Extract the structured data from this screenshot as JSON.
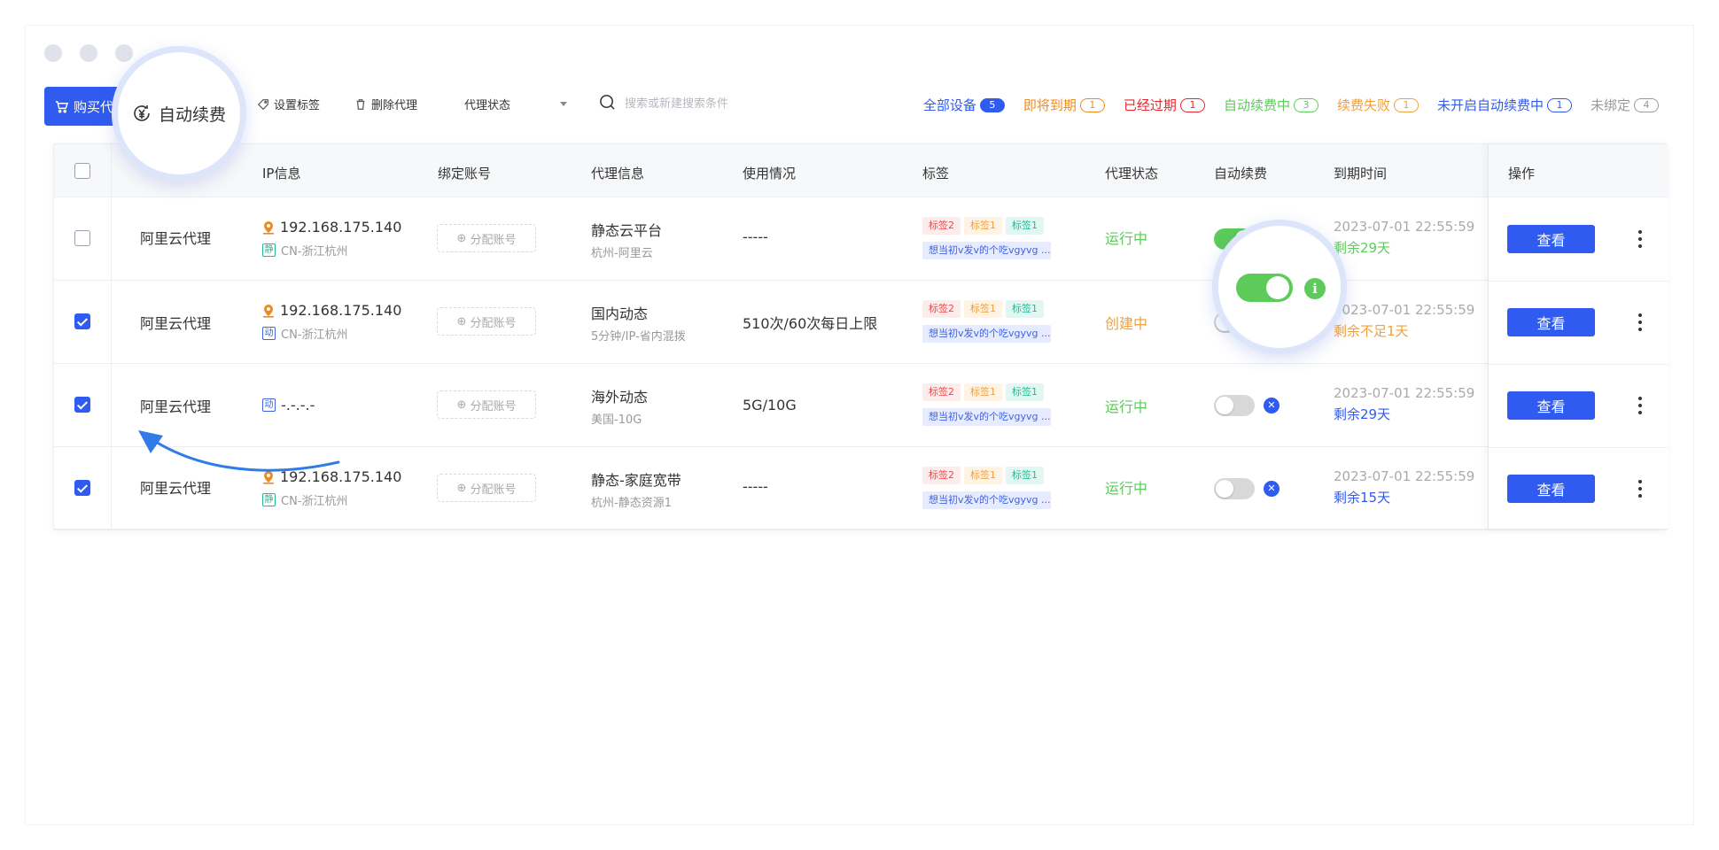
{
  "toolbar": {
    "buy_label": "购买代",
    "set_tag_label": "设置标签",
    "delete_label": "删除代理",
    "status_select_label": "代理状态",
    "search_placeholder": "搜索或新建搜索条件"
  },
  "callout": {
    "auto_renew_label": "自动续费"
  },
  "filters": [
    {
      "label": "全部设备",
      "count": "5",
      "color": "#2f5bf0"
    },
    {
      "label": "即将到期",
      "count": "1",
      "color": "#f08a1c"
    },
    {
      "label": "已经过期",
      "count": "1",
      "color": "#e9262d"
    },
    {
      "label": "自动续费中",
      "count": "3",
      "color": "#5ccb5a"
    },
    {
      "label": "续费失败",
      "count": "1",
      "color": "#f0a03c"
    },
    {
      "label": "未开启自动续费中",
      "count": "1",
      "color": "#2f5bf0"
    },
    {
      "label": "未绑定",
      "count": "4",
      "color": "#999999"
    }
  ],
  "table": {
    "headers": {
      "ip": "IP信息",
      "account": "绑定账号",
      "proxy": "代理信息",
      "usage": "使用情况",
      "tags": "标签",
      "state": "代理状态",
      "auto_renew": "自动续费",
      "expire": "到期时间",
      "ops": "操作"
    },
    "tag_labels": {
      "t2": "标签2",
      "t1a": "标签1",
      "t1b": "标签1",
      "long": "想当初v发v的个吃vgyvg ..."
    },
    "assign_label": "分配账号",
    "view_label": "查看",
    "rows": [
      {
        "name": "阿里云代理",
        "ip": "192.168.175.140",
        "ip_type": "静",
        "location": "CN-浙江杭州",
        "proxy_title": "静态云平台",
        "proxy_sub": "杭州-阿里云",
        "usage": "-----",
        "state": "运行中",
        "state_color": "#5ccb5a",
        "expire_date": "2023-07-01 22:55:59",
        "remain": "剩余29天",
        "remain_color": "#5ccb5a"
      },
      {
        "name": "阿里云代理",
        "ip": "192.168.175.140",
        "ip_type": "动",
        "location": "CN-浙江杭州",
        "proxy_title": "国内动态",
        "proxy_sub": "5分钟/IP-省内混拨",
        "usage": "510次/60次每日上限",
        "state": "创建中",
        "state_color": "#f0a03c",
        "expire_date": "2023-07-01 22:55:59",
        "remain": "剩余不足1天",
        "remain_color": "#f0a03c"
      },
      {
        "name": "阿里云代理",
        "ip": "-.-.-.-",
        "ip_type": "动",
        "location": "",
        "proxy_title": "海外动态",
        "proxy_sub": "美国-10G",
        "usage": "5G/10G",
        "state": "运行中",
        "state_color": "#5ccb5a",
        "expire_date": "2023-07-01 22:55:59",
        "remain": "剩余29天",
        "remain_color": "#2f5bf0"
      },
      {
        "name": "阿里云代理",
        "ip": "192.168.175.140",
        "ip_type": "静",
        "location": "CN-浙江杭州",
        "proxy_title": "静态-家庭宽带",
        "proxy_sub": "杭州-静态资源1",
        "usage": "-----",
        "state": "运行中",
        "state_color": "#5ccb5a",
        "expire_date": "2023-07-01 22:55:59",
        "remain": "剩余15天",
        "remain_color": "#2f5bf0"
      }
    ]
  }
}
